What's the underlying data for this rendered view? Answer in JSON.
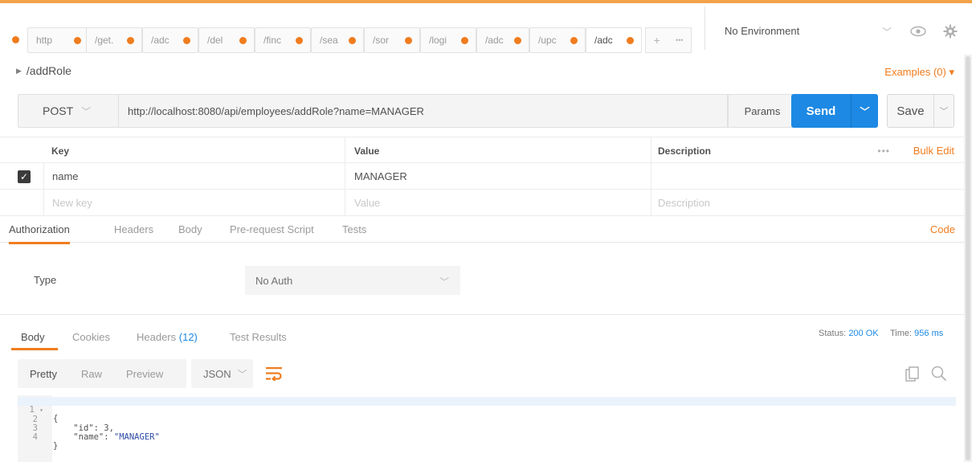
{
  "tabs": {
    "items": [
      {
        "label": "http"
      },
      {
        "label": "/get."
      },
      {
        "label": "/adc"
      },
      {
        "label": "/del"
      },
      {
        "label": "/finc"
      },
      {
        "label": "/sea"
      },
      {
        "label": "/sor"
      },
      {
        "label": "/logi"
      },
      {
        "label": "/adc"
      },
      {
        "label": "/upc"
      },
      {
        "label": "/adc"
      }
    ],
    "add_symbol": "+",
    "more_symbol": "•••"
  },
  "environment": {
    "selected": "No Environment"
  },
  "request": {
    "name": "/addRole",
    "examples_label": "Examples (0) ▾",
    "method": "POST",
    "url": "http://localhost:8080/api/employees/addRole?name=MANAGER",
    "params_label": "Params",
    "send_label": "Send",
    "save_label": "Save"
  },
  "params_table": {
    "headers": {
      "key": "Key",
      "value": "Value",
      "description": "Description"
    },
    "bulk_edit_label": "Bulk Edit",
    "more_dots": "•••",
    "rows": [
      {
        "checked": true,
        "key": "name",
        "value": "MANAGER",
        "description": ""
      }
    ],
    "new_row": {
      "key": "New key",
      "value": "Value",
      "description": "Description"
    }
  },
  "request_tabs": {
    "items": [
      "Authorization",
      "Headers",
      "Body",
      "Pre-request Script",
      "Tests"
    ],
    "active": "Authorization",
    "code_label": "Code"
  },
  "auth": {
    "type_label": "Type",
    "selected": "No Auth"
  },
  "response": {
    "tabs": {
      "body": "Body",
      "cookies": "Cookies",
      "headers": "Headers",
      "headers_count": "(12)",
      "test_results": "Test Results"
    },
    "status_label": "Status:",
    "status_value": "200 OK",
    "time_label": "Time:",
    "time_value": "956 ms",
    "formats": [
      "Pretty",
      "Raw",
      "Preview"
    ],
    "active_format": "Pretty",
    "language": "JSON",
    "code": {
      "line_numbers": [
        "1",
        "2",
        "3",
        "4"
      ],
      "open_brace": "{",
      "id_key": "\"id\"",
      "id_value": "3",
      "name_key": "\"name\"",
      "name_value": "\"MANAGER\"",
      "close_brace": "}"
    }
  },
  "colors": {
    "accent_orange": "#f07c1e",
    "send_blue": "#1d89e4",
    "top_bar": "#f4a24a"
  }
}
